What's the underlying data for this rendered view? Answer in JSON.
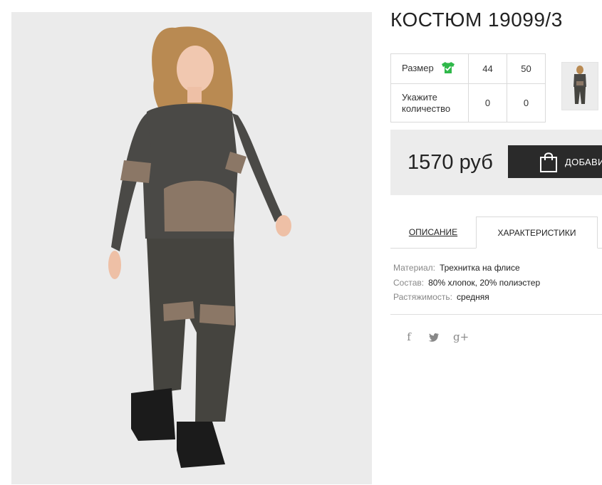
{
  "product": {
    "title": "КОСТЮМ 19099/3"
  },
  "size_table": {
    "size_label": "Размер",
    "size_icon": "tshirt-check-icon",
    "sizes": [
      "44",
      "50"
    ],
    "quantity_label": "Укажите количество",
    "quantities": [
      "0",
      "0"
    ]
  },
  "buy": {
    "price": "1570 руб",
    "add_button_label": "ДОБАВИТЬ",
    "button_icon": "shopping-bag-icon"
  },
  "tabs": {
    "description": "ОПИСАНИЕ",
    "characteristics": "ХАРАКТЕРИСТИКИ",
    "active": "characteristics"
  },
  "specs": [
    {
      "key": "Материал:",
      "value": "Трехнитка на флисе"
    },
    {
      "key": "Состав:",
      "value": "80% хлопок, 20% полиэстер"
    },
    {
      "key": "Растяжимость:",
      "value": "средняя"
    }
  ],
  "social": {
    "facebook": "f",
    "twitter": "twitter-icon",
    "googleplus": "g+"
  },
  "colors": {
    "accent_green": "#2fb84a",
    "button_dark": "#2a2a2a",
    "panel_gray": "#ececec"
  }
}
